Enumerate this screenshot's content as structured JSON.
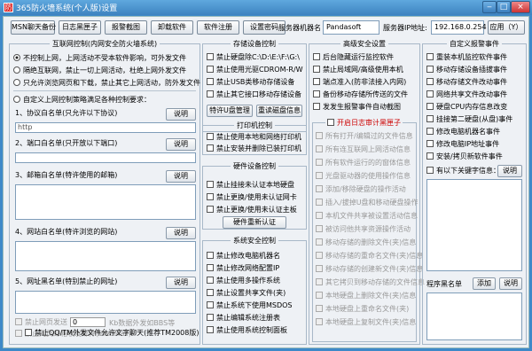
{
  "window": {
    "title": "365防火墙系统(个人版)设置",
    "app_icon": "防"
  },
  "toolbar": {
    "btn1": "MSN聊天备份",
    "btn2": "日志黑匣子",
    "btn3": "报警截图",
    "btn4": "卸载软件",
    "btn5": "软件注册",
    "btn6": "设置密码",
    "server_name_label": "服务器机器名",
    "server_name_value": "Pandasoft",
    "server_ip_label": "服务器IP地址:",
    "server_ip_value": "192.168.0.254",
    "apply": "应用（Y）"
  },
  "internet": {
    "title": "互联网控制(内网安全防火墙系统)",
    "radios": [
      "不控制上网，上网活动不受本软件影响，可外发文件",
      "隔绝互联网，禁止一切上网活动，杜绝上网外发文件",
      "只允许浏览网页和下载，禁止其它上网活动，防外发文件",
      "自定义上网控制策略满足各种控制要求："
    ],
    "sec1_label": "1、协议白名单(只允许以下协议)",
    "sec1_value": "http",
    "sec2_label": "2、端口白名单(只开放以下端口)",
    "sec3_label": "3、邮箱白名单(特许使用的邮箱)",
    "sec4_label": "4、网站白名单(特许浏览的网站)",
    "sec5_label": "5、网址黑名单(特别禁止的网址)",
    "explain": "说明",
    "forbid_upload": "禁止网页发送",
    "upload_value": "0",
    "upload_suffix": "Kb数据外发如BBS等",
    "forbid_webmail": "禁止网页邮箱收发邮件(WebMail)",
    "forbid_qq": "禁止QQ/TM外发文件允许文字聊天(推荐TM2008版)"
  },
  "storage": {
    "title": "存储设备控制",
    "items": [
      "禁止硬盘除C:\\D:\\E:\\F:\\G:\\",
      "禁止使用光驱CDROM-R/W",
      "禁止USB类移动存储设备",
      "禁止其它接口移动存储设备"
    ],
    "btn_special": "特许U盘管理",
    "btn_reread": "重读磁盘信息"
  },
  "printer": {
    "title": "打印机控制",
    "items": [
      "禁止使用本地和网络打印机",
      "禁止安装并删除已装打印机"
    ]
  },
  "hardware": {
    "title": "硬件设备控制",
    "items": [
      "禁止挂接未认证本地硬盘",
      "禁止更换/使用未认证网卡",
      "禁止更换/使用未认证主板"
    ],
    "btn": "硬件重新认证"
  },
  "system": {
    "title": "系统安全控制",
    "items": [
      "禁止修改电脑机器名",
      "禁止修改网络配置IP",
      "禁止使用多操作系统",
      "禁止设置共享文件(夹)",
      "禁止系统下使用MSDOS",
      "禁止编辑系统注册表",
      "禁止使用系统控制面板"
    ]
  },
  "advanced": {
    "title": "高级安全设置",
    "items": [
      "后台隐藏运行监控软件",
      "禁止局域网/高级使用本机",
      "端点准入(防非法接入内网)",
      "备份移动存储所传送的文件",
      "发发生报警事件自动截图"
    ],
    "blackbox_title": "开启日志审计黑匣子",
    "blackbox_items": [
      "所有打开/编辑过的文件信息",
      "所有连互联网上网活动信息",
      "所有软件运行的的窗体信息",
      "光盘驱动器的使用操作信息",
      "添加/移除硬盘的操作活动",
      "插入/拔掉U盘和移动硬盘操作",
      "本机文件共享被设置活动信息",
      "被访问他共享资源操作活动",
      "移动存储的删除文件(夹)信息",
      "移动存储的重命名文件(夹)信息",
      "移动存储的创建新文件(夹)信息",
      "其它拷贝到移动存储的文件信息",
      "本地硬盘上删除文件(夹)信息",
      "本地硬盘上重命名文件(夹)",
      "本地硬盘上复制文件(夹)信息"
    ]
  },
  "alerts": {
    "title": "自定义报警事件",
    "items": [
      "重装本机监控软件事件",
      "移动存储设备插拔事件",
      "移动存储文件改动事件",
      "网络共享文件改动事件",
      "硬盘CPU内存信息改变",
      "挂接第二硬盘(从盘)事件",
      "修改电脑机器名事件",
      "修改电脑IP地址事件",
      "安装/拷贝新软件事件",
      "有以下关键字信息："
    ],
    "explain": "说明",
    "blacklist_label": "程序黑名单",
    "add": "添加",
    "explain2": "说明"
  }
}
